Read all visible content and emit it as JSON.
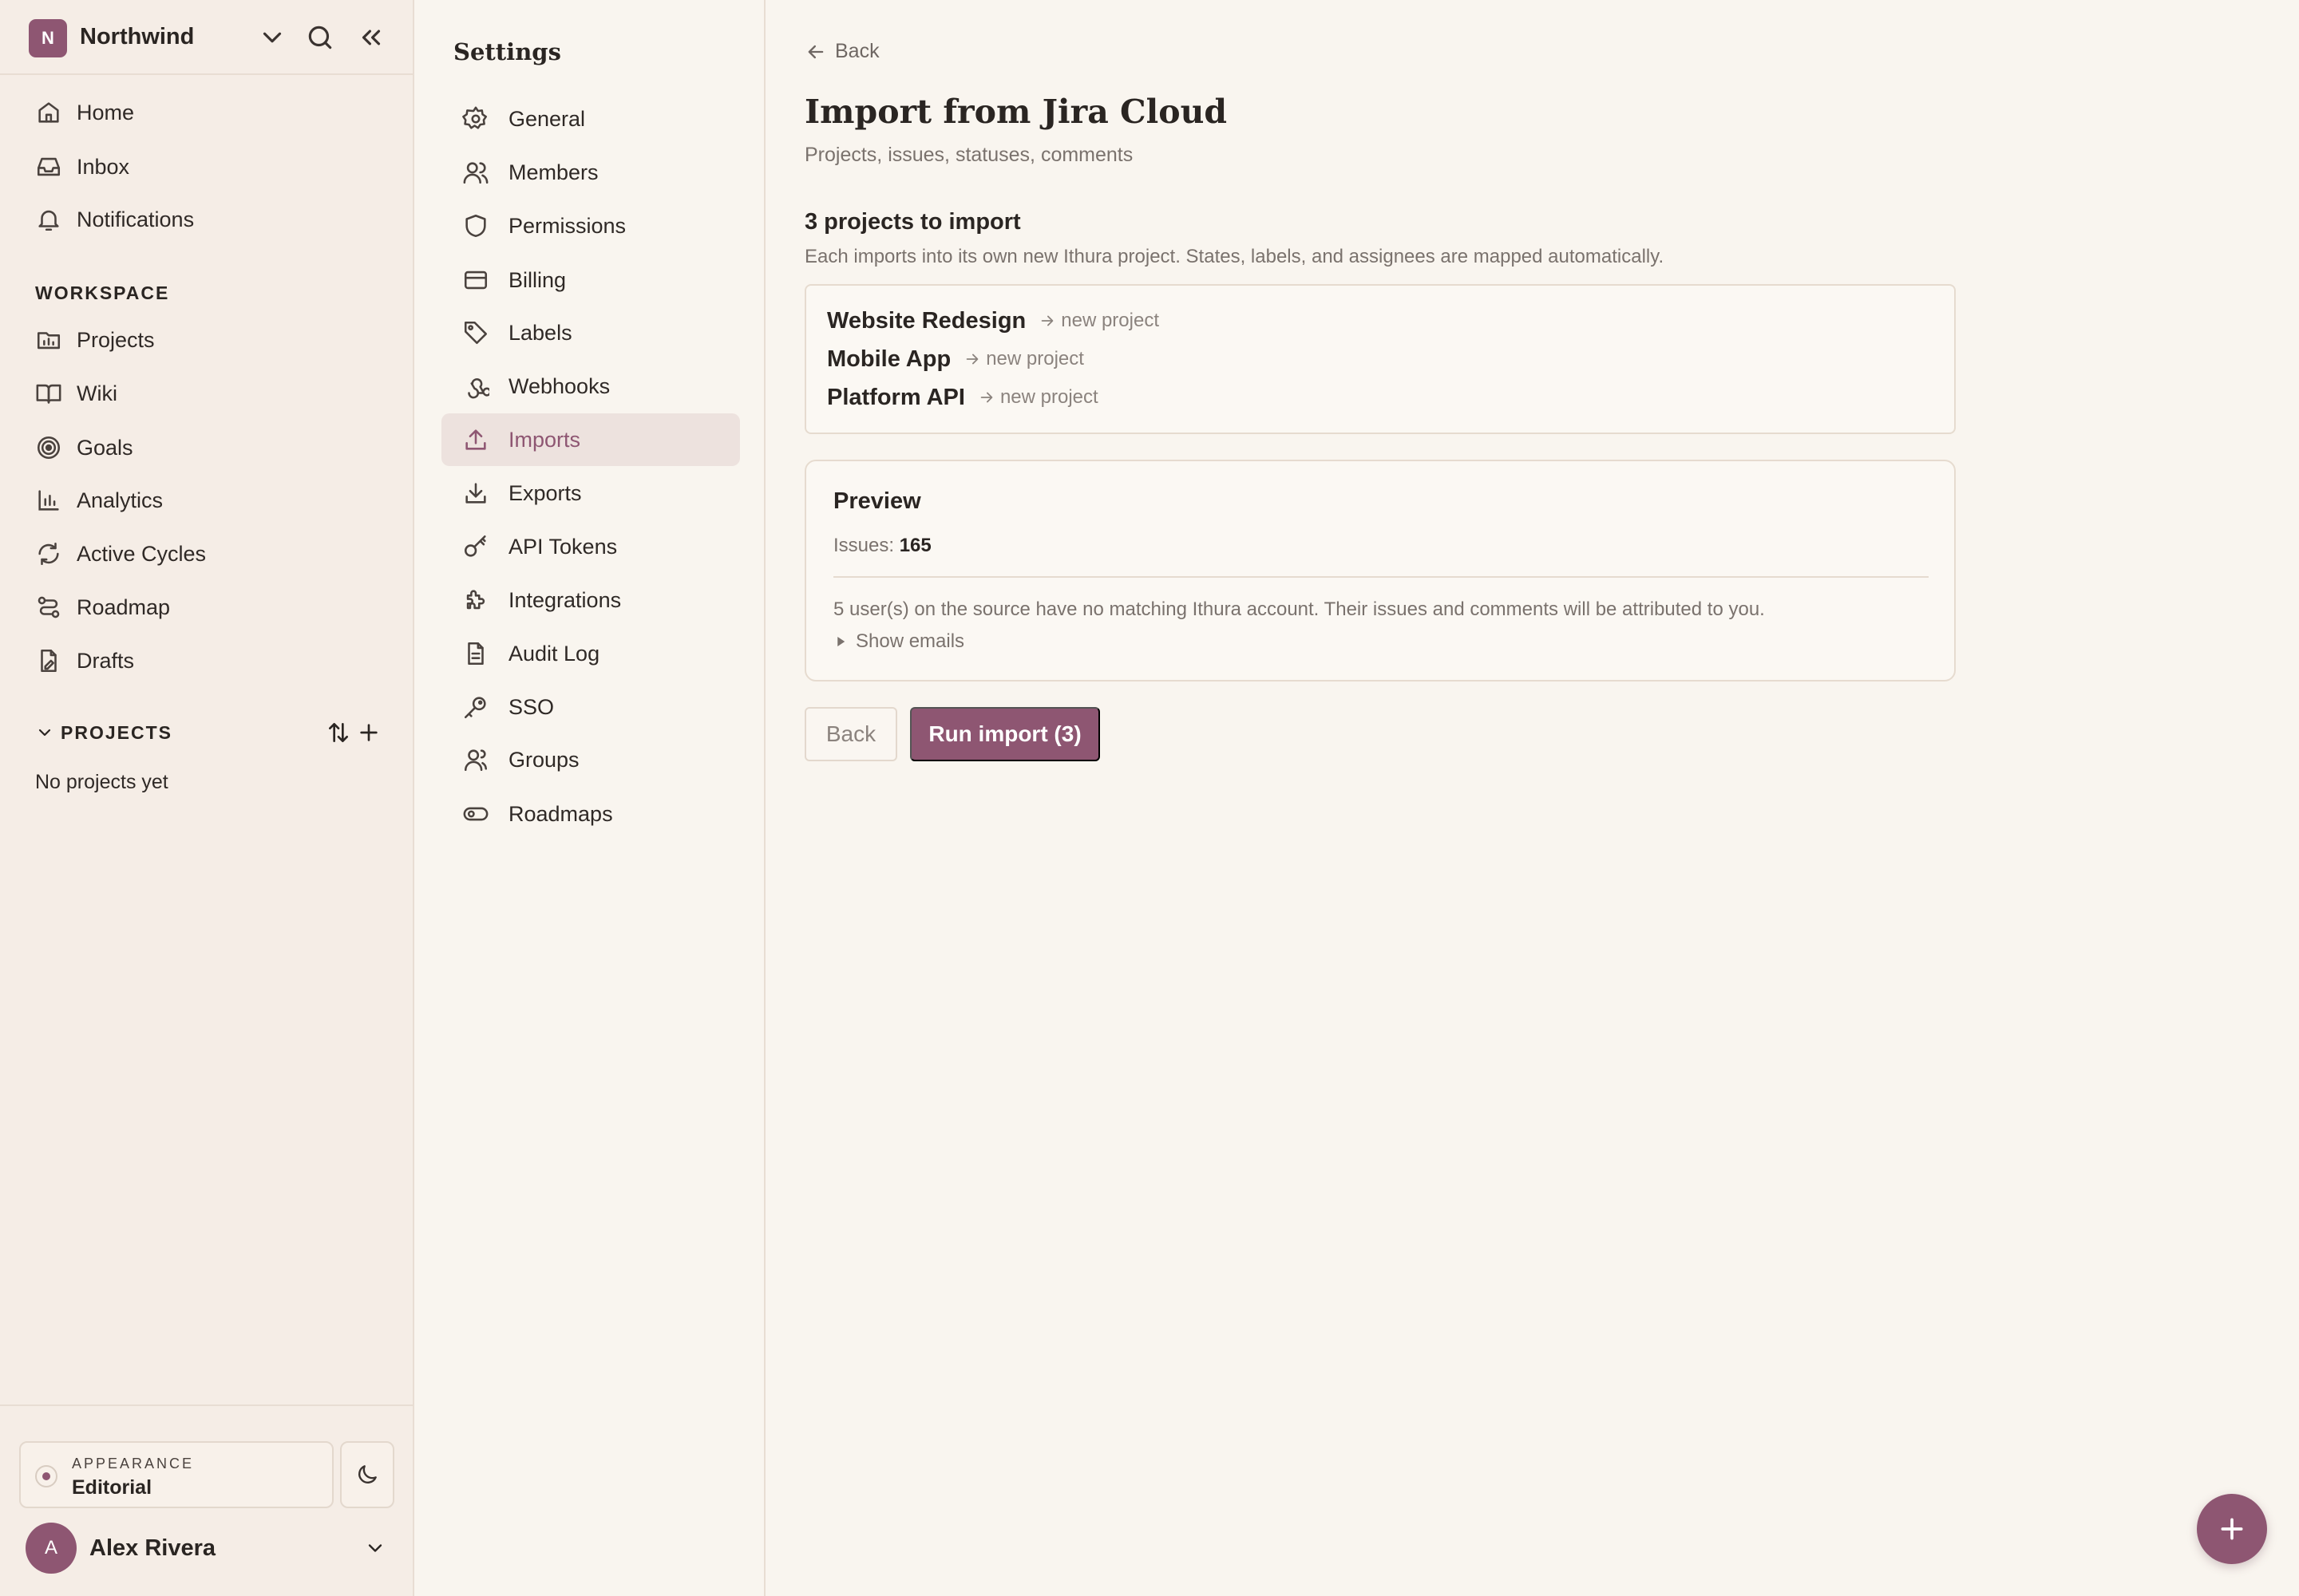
{
  "workspace": {
    "initial": "N",
    "name": "Northwind"
  },
  "nav": {
    "items": [
      {
        "label": "Home",
        "icon": "home-icon"
      },
      {
        "label": "Inbox",
        "icon": "inbox-icon"
      },
      {
        "label": "Notifications",
        "icon": "bell-icon"
      }
    ]
  },
  "workspace_section": {
    "title": "WORKSPACE",
    "items": [
      {
        "label": "Projects",
        "icon": "projects-icon"
      },
      {
        "label": "Wiki",
        "icon": "book-icon"
      },
      {
        "label": "Goals",
        "icon": "target-icon"
      },
      {
        "label": "Analytics",
        "icon": "bar-chart-icon"
      },
      {
        "label": "Active Cycles",
        "icon": "refresh-icon"
      },
      {
        "label": "Roadmap",
        "icon": "route-icon"
      },
      {
        "label": "Drafts",
        "icon": "draft-icon"
      }
    ]
  },
  "projects_section": {
    "title": "PROJECTS",
    "empty": "No projects yet"
  },
  "appearance": {
    "caption": "APPEARANCE",
    "value": "Editorial"
  },
  "user": {
    "initial": "A",
    "name": "Alex Rivera"
  },
  "settings": {
    "title": "Settings",
    "active": "Imports",
    "items": [
      {
        "label": "General",
        "icon": "gear-icon"
      },
      {
        "label": "Members",
        "icon": "users-icon"
      },
      {
        "label": "Permissions",
        "icon": "shield-icon"
      },
      {
        "label": "Billing",
        "icon": "credit-card-icon"
      },
      {
        "label": "Labels",
        "icon": "tag-icon"
      },
      {
        "label": "Webhooks",
        "icon": "webhook-icon"
      },
      {
        "label": "Imports",
        "icon": "upload-icon"
      },
      {
        "label": "Exports",
        "icon": "download-icon"
      },
      {
        "label": "API Tokens",
        "icon": "key-icon"
      },
      {
        "label": "Integrations",
        "icon": "puzzle-icon"
      },
      {
        "label": "Audit Log",
        "icon": "document-icon"
      },
      {
        "label": "SSO",
        "icon": "key-round-icon"
      },
      {
        "label": "Groups",
        "icon": "group-icon"
      },
      {
        "label": "Roadmaps",
        "icon": "toggle-icon"
      }
    ]
  },
  "main": {
    "back_label": "Back",
    "title": "Import from Jira Cloud",
    "subtitle": "Projects, issues, statuses, comments",
    "count_title": "3 projects to import",
    "count_desc": "Each imports into its own new Ithura project. States, labels, and assignees are mapped automatically.",
    "projects": [
      {
        "name": "Website Redesign",
        "target": "new project"
      },
      {
        "name": "Mobile App",
        "target": "new project"
      },
      {
        "name": "Platform API",
        "target": "new project"
      }
    ],
    "preview": {
      "title": "Preview",
      "issues_label": "Issues:",
      "issues_value": "165",
      "warning": "5 user(s) on the source have no matching Ithura account. Their issues and comments will be attributed to you.",
      "toggle_label": "Show emails"
    },
    "buttons": {
      "back": "Back",
      "run": "Run import (3)"
    }
  },
  "colors": {
    "accent": "#8e5672",
    "background": "#f9f5ef",
    "sidebar": "#f5ede6"
  }
}
